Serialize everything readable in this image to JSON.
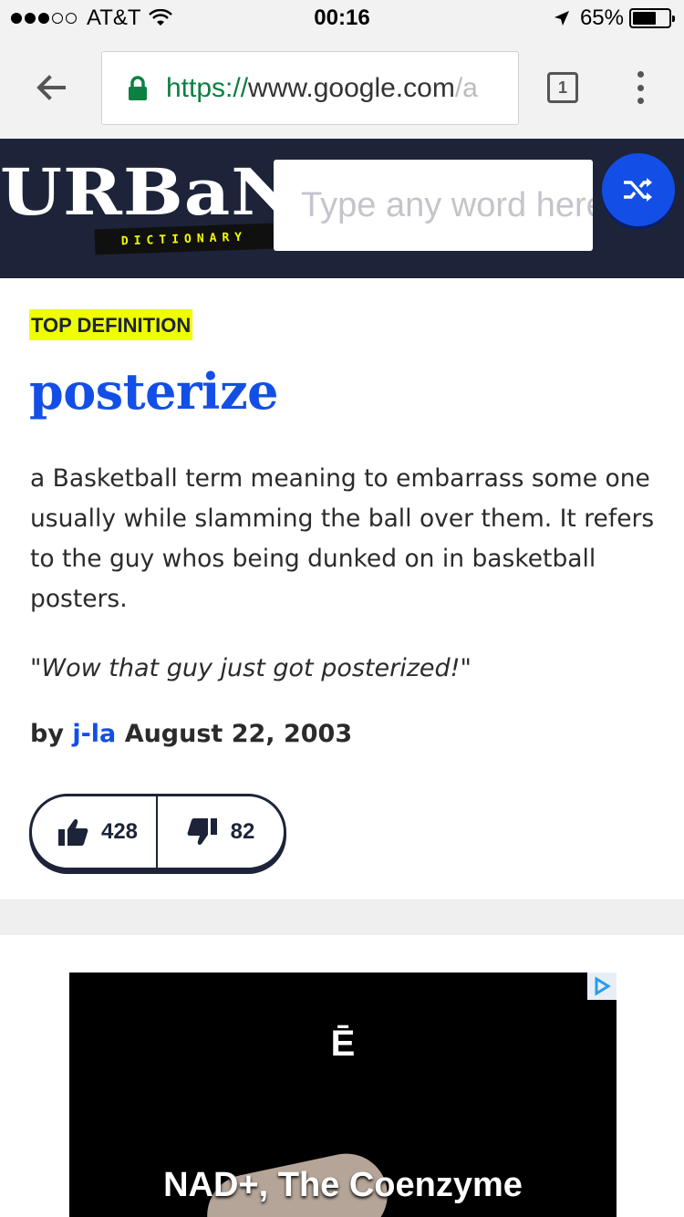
{
  "status_bar": {
    "carrier": "AT&T",
    "time": "00:16",
    "battery": "65%",
    "battery_level": 0.65,
    "signal_bars_filled": 3,
    "signal_bars_total": 5
  },
  "browser": {
    "url_scheme": "https://",
    "url_host": "www.google.com",
    "url_fade": "/a",
    "tab_count": "1"
  },
  "site": {
    "logo_word": "URBaN",
    "logo_tag": "DICTIONARY",
    "search_placeholder": "Type any word here",
    "colors": {
      "header_bg": "#1d2439",
      "accent_blue": "#134fe6",
      "badge_yellow": "#efff00"
    }
  },
  "definition": {
    "badge": "TOP DEFINITION",
    "word": "posterize",
    "meaning": "a Basketball term meaning to embarrass some one usually while slamming the ball over them. It refers to the guy whos being dunked on in basketball posters.",
    "example": "\"Wow that guy just got posterized!\"",
    "by_label": "by",
    "author": "j-la",
    "date": "August 22, 2003",
    "upvotes": "428",
    "downvotes": "82"
  },
  "ad": {
    "logo": "Ē",
    "headline": "NAD+, The Coenzyme"
  }
}
